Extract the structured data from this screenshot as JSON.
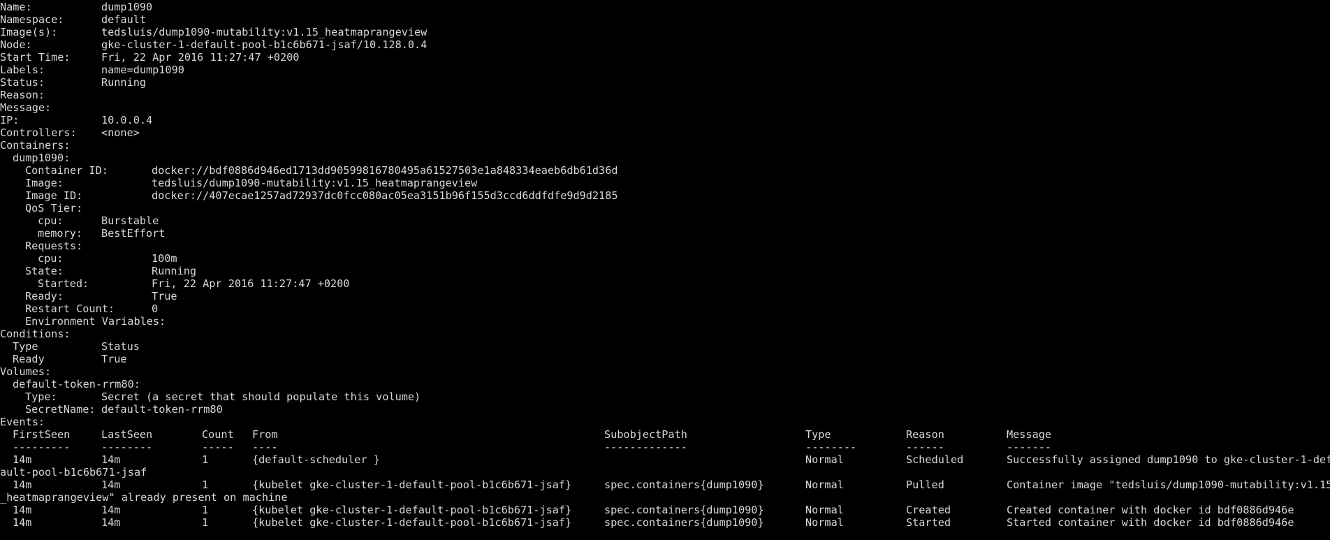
{
  "terminal": {
    "top_partial": "Name:           dump1090                          (cut off)",
    "header": [
      {
        "key": "Name:",
        "value": "dump1090"
      },
      {
        "key": "Namespace:",
        "value": "default"
      },
      {
        "key": "Image(s):",
        "value": "tedsluis/dump1090-mutability:v1.15_heatmaprangeview"
      },
      {
        "key": "Node:",
        "value": "gke-cluster-1-default-pool-b1c6b671-jsaf/10.128.0.4"
      },
      {
        "key": "Start Time:",
        "value": "Fri, 22 Apr 2016 11:27:47 +0200"
      },
      {
        "key": "Labels:",
        "value": "name=dump1090"
      },
      {
        "key": "Status:",
        "value": "Running"
      },
      {
        "key": "Reason:",
        "value": ""
      },
      {
        "key": "Message:",
        "value": ""
      },
      {
        "key": "IP:",
        "value": "10.0.0.4"
      },
      {
        "key": "Controllers:",
        "value": "<none>"
      }
    ],
    "containers_label": "Containers:",
    "container_name": "dump1090:",
    "container": [
      {
        "key": "Container ID:",
        "value": "docker://bdf0886d946ed1713dd90599816780495a61527503e1a848334eaeb6db61d36d"
      },
      {
        "key": "Image:",
        "value": "tedsluis/dump1090-mutability:v1.15_heatmaprangeview"
      },
      {
        "key": "Image ID:",
        "value": "docker://407ecae1257ad72937dc0fcc080ac05ea3151b96f155d3ccd6ddfdfe9d9d2185"
      }
    ],
    "qos_label": "QoS Tier:",
    "qos": [
      {
        "key": "cpu:",
        "value": "Burstable"
      },
      {
        "key": "memory:",
        "value": "BestEffort"
      }
    ],
    "requests_label": "Requests:",
    "requests": [
      {
        "key": "cpu:",
        "value": "100m"
      }
    ],
    "state": {
      "key": "State:",
      "value": "Running"
    },
    "started": {
      "key": "Started:",
      "value": "Fri, 22 Apr 2016 11:27:47 +0200"
    },
    "ready": {
      "key": "Ready:",
      "value": "True"
    },
    "restart_count": {
      "key": "Restart Count:",
      "value": "0"
    },
    "env_label": "Environment Variables:",
    "conditions_label": "Conditions:",
    "conditions_header": {
      "type": "Type",
      "status": "Status"
    },
    "conditions": [
      {
        "type": "Ready",
        "status": "True"
      }
    ],
    "volumes_label": "Volumes:",
    "volume_name": "default-token-rrm80:",
    "volume": [
      {
        "key": "Type:",
        "value": "Secret (a secret that should populate this volume)"
      },
      {
        "key": "SecretName:",
        "value": "default-token-rrm80"
      }
    ],
    "events_label": "Events:",
    "events_header": {
      "first_seen": "FirstSeen",
      "last_seen": "LastSeen",
      "count": "Count",
      "from": "From",
      "subobject_path": "SubobjectPath",
      "type": "Type",
      "reason": "Reason",
      "message": "Message"
    },
    "events_dashes": {
      "first_seen": "---------",
      "last_seen": "--------",
      "count": "-----",
      "from": "----",
      "subobject_path": "-------------",
      "type": "--------",
      "reason": "------",
      "message": "-------"
    },
    "events": [
      {
        "first_seen": "14m",
        "last_seen": "14m",
        "count": "1",
        "from": "{default-scheduler }",
        "subobject_path": "",
        "type": "Normal",
        "reason": "Scheduled",
        "message": "Successfully assigned dump1090 to gke-cluster-1-def",
        "wrap": "ault-pool-b1c6b671-jsaf"
      },
      {
        "first_seen": "14m",
        "last_seen": "14m",
        "count": "1",
        "from": "{kubelet gke-cluster-1-default-pool-b1c6b671-jsaf}",
        "subobject_path": "spec.containers{dump1090}",
        "type": "Normal",
        "reason": "Pulled",
        "message": "Container image \"tedsluis/dump1090-mutability:v1.15",
        "wrap": "_heatmaprangeview\" already present on machine"
      },
      {
        "first_seen": "14m",
        "last_seen": "14m",
        "count": "1",
        "from": "{kubelet gke-cluster-1-default-pool-b1c6b671-jsaf}",
        "subobject_path": "spec.containers{dump1090}",
        "type": "Normal",
        "reason": "Created",
        "message": "Created container with docker id bdf0886d946e",
        "wrap": ""
      },
      {
        "first_seen": "14m",
        "last_seen": "14m",
        "count": "1",
        "from": "{kubelet gke-cluster-1-default-pool-b1c6b671-jsaf}",
        "subobject_path": "spec.containers{dump1090}",
        "type": "Normal",
        "reason": "Started",
        "message": "Started container with docker id bdf0886d946e",
        "wrap": ""
      }
    ]
  }
}
